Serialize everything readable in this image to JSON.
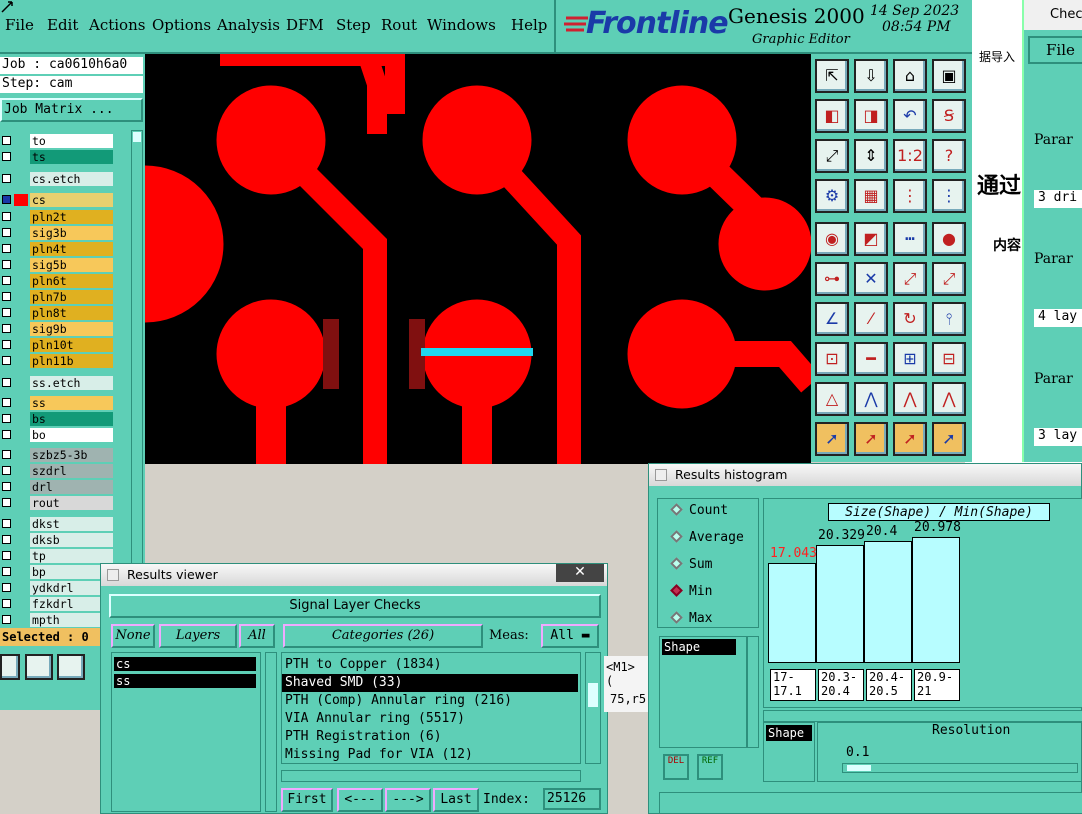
{
  "menu": {
    "items": [
      "File",
      "Edit",
      "Actions",
      "Options",
      "Analysis",
      "DFM",
      "Step",
      "Rout",
      "Windows",
      "Help"
    ]
  },
  "brand": {
    "logo": "Frontline",
    "product": "Genesis 2000",
    "subtitle": "Graphic Editor",
    "date": "14 Sep 2023",
    "time": "08:54 PM"
  },
  "job": {
    "job_label": "Job : ca0610h6a0",
    "step_label": "Step: cam",
    "matrix_button": "Job Matrix ..."
  },
  "layers": [
    {
      "name": "to",
      "color": "#ffffff"
    },
    {
      "name": "ts",
      "color": "#129a78"
    },
    {
      "name": "cs.etch",
      "color": "#d8eee8"
    },
    {
      "name": "cs",
      "color": "#e8d070"
    },
    {
      "name": "pln2t",
      "color": "#e0b020"
    },
    {
      "name": "sig3b",
      "color": "#f7c85a"
    },
    {
      "name": "pln4t",
      "color": "#e0b020"
    },
    {
      "name": "sig5b",
      "color": "#f7c85a"
    },
    {
      "name": "pln6t",
      "color": "#e0b020"
    },
    {
      "name": "pln7b",
      "color": "#e0b020"
    },
    {
      "name": "pln8t",
      "color": "#e0b020"
    },
    {
      "name": "sig9b",
      "color": "#f7c85a"
    },
    {
      "name": "pln10t",
      "color": "#e0b020"
    },
    {
      "name": "pln11b",
      "color": "#e0b020"
    },
    {
      "name": "ss.etch",
      "color": "#d8eee8"
    },
    {
      "name": "ss",
      "color": "#f7c85a"
    },
    {
      "name": "bs",
      "color": "#129a78"
    },
    {
      "name": "bo",
      "color": "#ffffff"
    },
    {
      "name": "szbz5-3b",
      "color": "#9fb3b0"
    },
    {
      "name": "szdrl",
      "color": "#9fb3b0"
    },
    {
      "name": "drl",
      "color": "#9fb3b0"
    },
    {
      "name": "rout",
      "color": "#d8d8d8"
    },
    {
      "name": "dkst",
      "color": "#d8eee8"
    },
    {
      "name": "dksb",
      "color": "#d8eee8"
    },
    {
      "name": "tp",
      "color": "#d8eee8"
    },
    {
      "name": "bp",
      "color": "#d8eee8"
    },
    {
      "name": "ydkdrl",
      "color": "#d8eee8"
    },
    {
      "name": "fzkdrl",
      "color": "#d8eee8"
    },
    {
      "name": "mpth",
      "color": "#d8eee8"
    }
  ],
  "selected_label": "Selected : 0",
  "results_viewer": {
    "title": "Results viewer",
    "group": "Signal Layer Checks",
    "none_btn": "None",
    "layers_btn": "Layers",
    "all_btn": "All",
    "categories_btn": "Categories (26)",
    "meas_label": "Meas:",
    "meas_value": "All",
    "layer_list": [
      "cs",
      "ss"
    ],
    "categories": [
      "PTH to Copper (1834)",
      "Shaved SMD (33)",
      "PTH (Comp) Annular ring (216)",
      "VIA Annular ring (5517)",
      "PTH Registration (6)",
      "Missing Pad for VIA (12)"
    ],
    "selected_category": 1,
    "first_btn": "First",
    "prev_btn": "<---",
    "next_btn": "--->",
    "last_btn": "Last",
    "index_label": "Index:",
    "index_value": "25126",
    "side_text_1": "<M1> (",
    "side_text_2": "75,r5"
  },
  "histogram": {
    "title": "Results histogram",
    "modes": [
      "Count",
      "Average",
      "Sum",
      "Min",
      "Max"
    ],
    "active_mode": "Min",
    "chart_title": "Size(Shape) / Min(Shape)",
    "shape_label": "Shape",
    "bars": [
      {
        "value": "17.043",
        "range": "17-\n17.1",
        "color": "#ff2020"
      },
      {
        "value": "20.329",
        "range": "20.3-\n20.4",
        "color": "#000"
      },
      {
        "value": "20.4",
        "range": "20.4-\n20.5",
        "color": "#000"
      },
      {
        "value": "20.978",
        "range": "20.9-\n21",
        "color": "#000"
      }
    ],
    "shape_bottom": "Shape",
    "resolution_label": "Resolution",
    "resolution_value": "0.1",
    "del_label": "DEL",
    "ref_label": "REF"
  },
  "background": {
    "check_title": "Check",
    "file_menu": "File",
    "cn1": "据导入",
    "cn2": "通过",
    "cn3": "内容",
    "param1": "Parar",
    "param2": "Parar",
    "param3": "Parar",
    "row1": "3 dri",
    "row2": "4 lay",
    "row3": "3 lay"
  }
}
